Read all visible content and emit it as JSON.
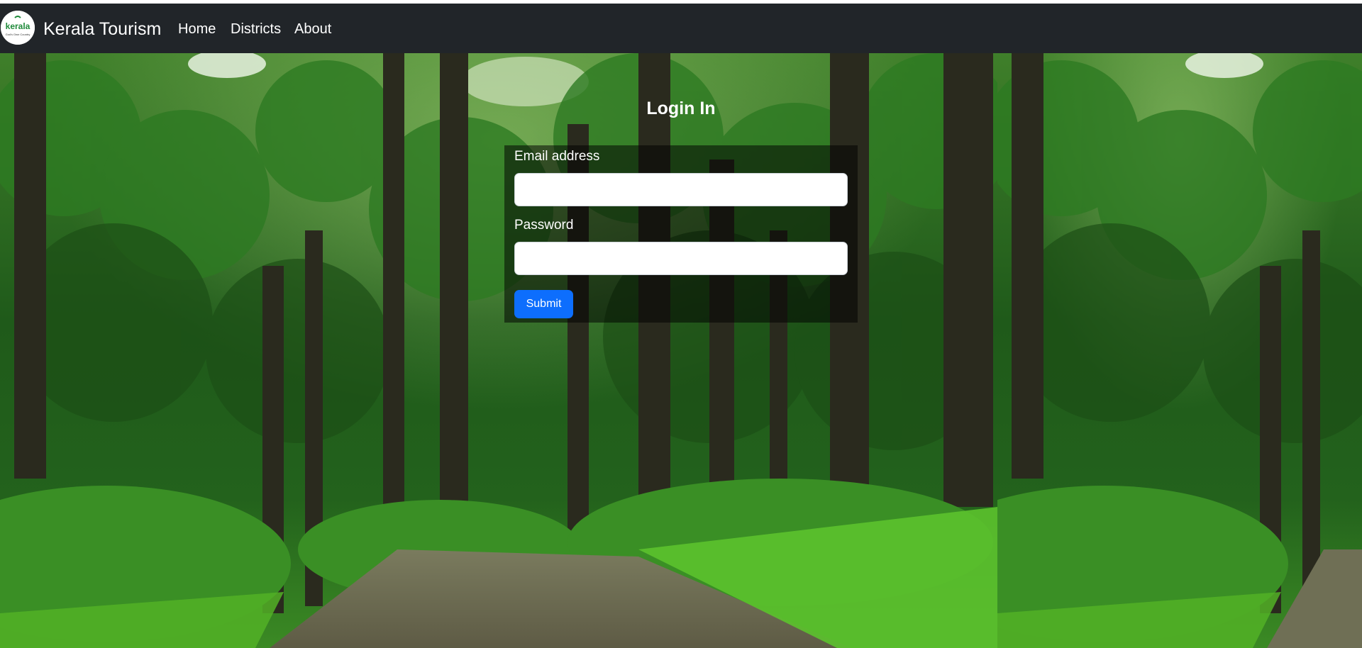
{
  "navbar": {
    "brand_logo_text": "kerala",
    "brand_logo_subtext": "God's Own Country",
    "brand_title": "Kerala Tourism",
    "links": [
      "Home",
      "Districts",
      "About"
    ]
  },
  "login": {
    "title": "Login In",
    "email_label": "Email address",
    "email_value": "",
    "password_label": "Password",
    "password_value": "",
    "submit_label": "Submit"
  },
  "colors": {
    "navbar_bg": "#212529",
    "primary_button": "#0d6efd",
    "forest_green": "#2e7d32"
  },
  "icons": {
    "logo": "kerala-tourism-logo"
  }
}
